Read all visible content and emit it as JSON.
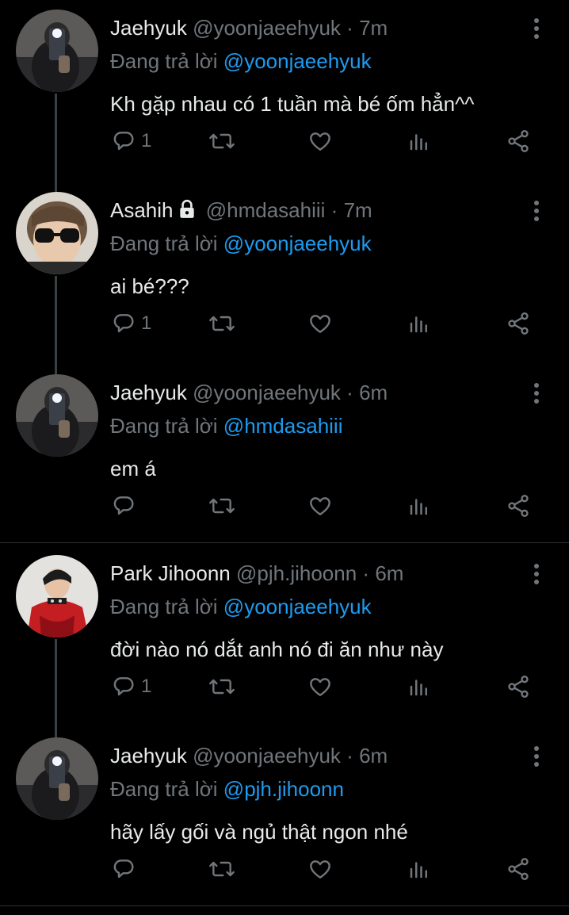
{
  "tweets": [
    {
      "name": "Jaehyuk",
      "handle": "@yoonjaeehyuk",
      "dot": "·",
      "time": "7m",
      "replying_prefix": "Đang trả lời",
      "replying_to": "@yoonjaeehyuk",
      "text": "Kh gặp nhau có 1 tuần mà bé ốm hẳn^^",
      "reply_count": "1",
      "locked": false
    },
    {
      "name": "Asahih",
      "handle": "@hmdasahiii",
      "dot": "·",
      "time": "7m",
      "replying_prefix": "Đang trả lời",
      "replying_to": "@yoonjaeehyuk",
      "text": "ai bé???",
      "reply_count": "1",
      "locked": true
    },
    {
      "name": "Jaehyuk",
      "handle": "@yoonjaeehyuk",
      "dot": "·",
      "time": "6m",
      "replying_prefix": "Đang trả lời",
      "replying_to": "@hmdasahiii",
      "text": "em á",
      "reply_count": "",
      "locked": false
    },
    {
      "name": "Park Jihoonn",
      "handle": "@pjh.jihoonn",
      "dot": "·",
      "time": "6m",
      "replying_prefix": "Đang trả lời",
      "replying_to": "@yoonjaeehyuk",
      "text": "đời nào nó dắt anh nó đi ăn như này",
      "reply_count": "1",
      "locked": false
    },
    {
      "name": "Jaehyuk",
      "handle": "@yoonjaeehyuk",
      "dot": "·",
      "time": "6m",
      "replying_prefix": "Đang trả lời",
      "replying_to": "@pjh.jihoonn",
      "text": "hãy lấy gối và ngủ thật ngon nhé",
      "reply_count": "",
      "locked": false
    }
  ],
  "icons": {
    "more": "more-vertical-icon",
    "reply": "reply-bubble-icon",
    "retweet": "retweet-icon",
    "like": "heart-icon",
    "views": "views-bar-chart-icon",
    "share": "share-icon",
    "lock": "lock-icon"
  },
  "colors": {
    "background": "#000000",
    "text": "#e7e9ea",
    "muted": "#71767b",
    "mention": "#1d9bf0",
    "divider": "#2f3336",
    "thread_line": "#3a3f44"
  }
}
